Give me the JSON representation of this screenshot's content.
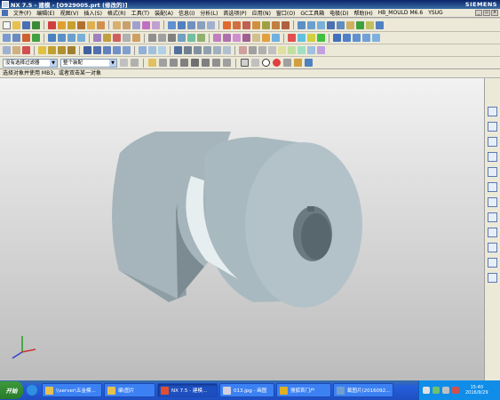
{
  "titlebar": {
    "title": "NX 7.5 - 建模 - [O929005.prt (修改的)]",
    "brand": "SIEMENS"
  },
  "menu": [
    "文件(F)",
    "编辑(E)",
    "视图(V)",
    "插入(S)",
    "格式(R)",
    "工具(T)",
    "装配(A)",
    "信息(I)",
    "分析(L)",
    "首选项(P)",
    "应用(N)",
    "窗口(O)",
    "GC工具箱",
    "电极(D)",
    "帮助(H)",
    "HB_MOULD M6.6",
    "YSUG"
  ],
  "selection_bar": {
    "filter_value": "没有选择过滤器",
    "assembly_value": "整个装配"
  },
  "prompt": {
    "text": "选择对象并使用 MB3，或者双击某一对象"
  },
  "colors": {
    "part_side": "#9aa9b0",
    "part_face": "#a9b9c0",
    "part_dark": "#7f8e95",
    "part_hole": "#5d6b72",
    "titlebar": "#0a246a",
    "taskbar": "#245edb",
    "viewport_top": "#f2f2f2",
    "viewport_bottom": "#bcbcbc"
  },
  "taskbar": {
    "start_label": "开始",
    "tasks": [
      {
        "label": "\\\\server\\五金模...",
        "active": false
      },
      {
        "label": "编\\图片",
        "active": false
      },
      {
        "label": "NX 7.5 - 建模...",
        "active": true
      },
      {
        "label": "013.jpg - 画图",
        "active": false
      },
      {
        "label": "搜狐首门户",
        "active": false
      },
      {
        "label": "截图片(2016092...",
        "active": false
      }
    ],
    "clock_time": "15:40",
    "clock_date": "2016/9/29"
  }
}
